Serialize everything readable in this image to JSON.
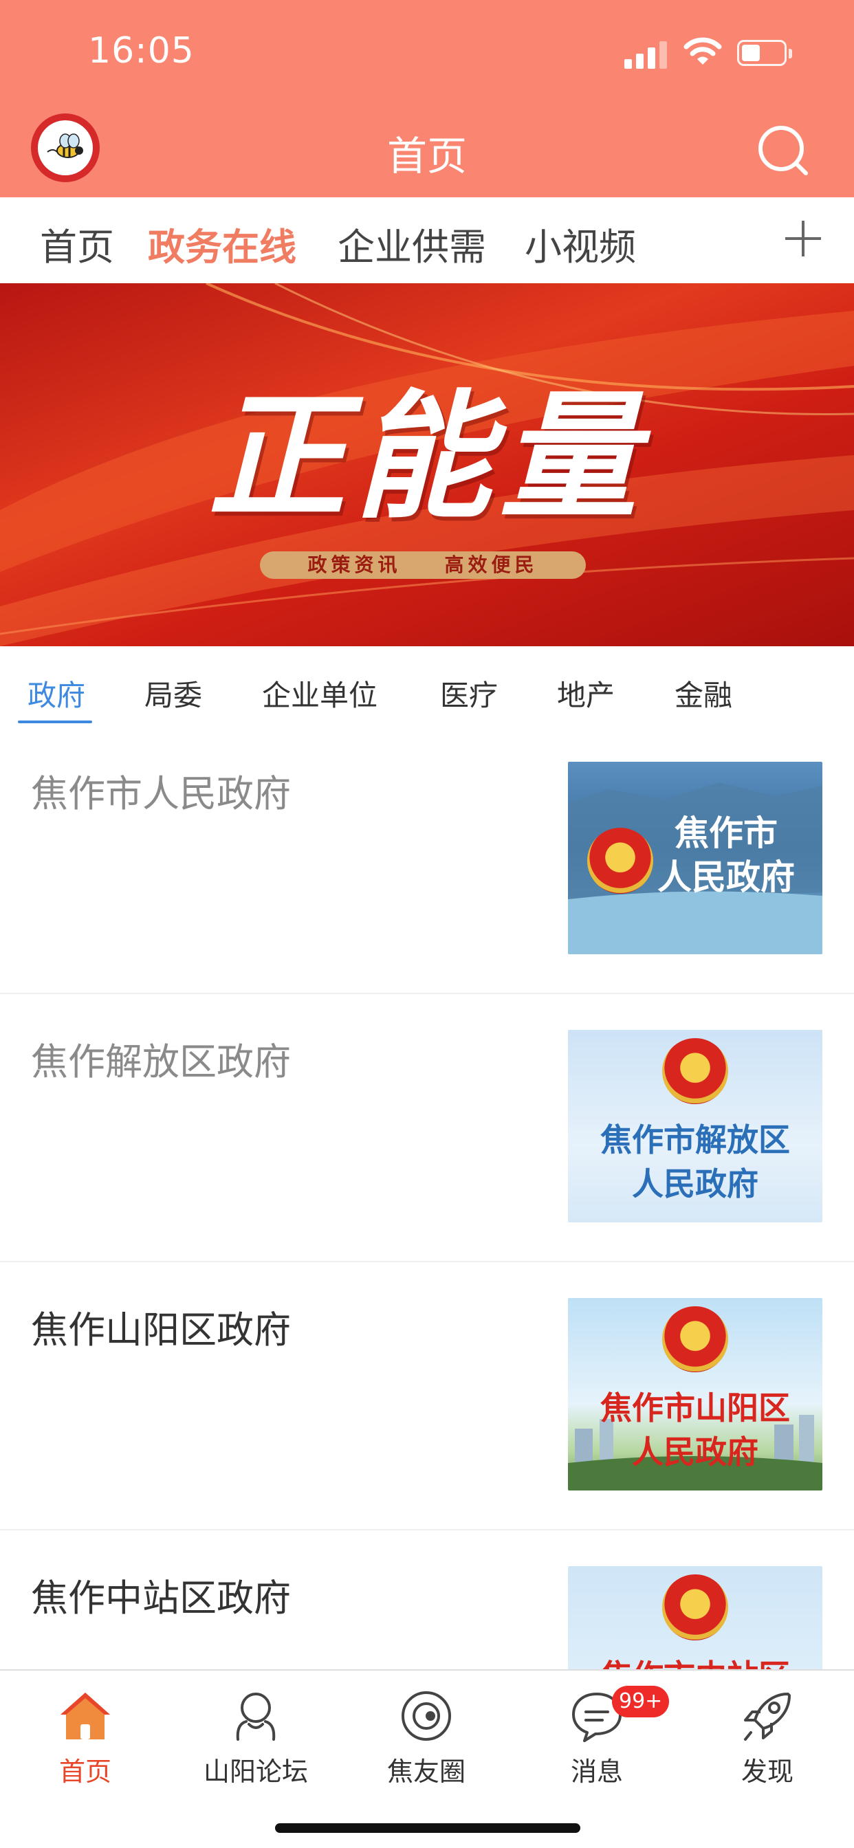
{
  "status_bar": {
    "time": "16:05",
    "battery_level": 0.45
  },
  "header": {
    "title": "首页",
    "avatar_icon": "bee-logo-icon",
    "search_icon": "search-icon",
    "bg_color": "#fa8570"
  },
  "channel_tabs": {
    "items": [
      {
        "label": "首页",
        "active": false
      },
      {
        "label": "政务在线",
        "active": true
      },
      {
        "label": "企业供需",
        "active": false
      },
      {
        "label": "小视频",
        "active": false
      }
    ],
    "add_icon": "plus-icon",
    "active_color": "#f07c62"
  },
  "banner": {
    "headline": "正能量",
    "subline": "政策资讯    高效便民"
  },
  "category_tabs": {
    "items": [
      {
        "label": "政府",
        "active": true
      },
      {
        "label": "局委",
        "active": false
      },
      {
        "label": "企业单位",
        "active": false
      },
      {
        "label": "医疗",
        "active": false
      },
      {
        "label": "地产",
        "active": false
      },
      {
        "label": "金融",
        "active": false
      }
    ],
    "active_color": "#3d8ae0"
  },
  "list": {
    "items": [
      {
        "title": "焦作市人民政府",
        "read": true,
        "thumb_text": "焦作市\n人民政府",
        "thumb_text_color": "#ffffff"
      },
      {
        "title": "焦作解放区政府",
        "read": true,
        "thumb_text": "焦作市解放区\n人民政府",
        "thumb_text_color": "#2a6fb8"
      },
      {
        "title": "焦作山阳区政府",
        "read": false,
        "thumb_text": "焦作市山阳区\n人民政府",
        "thumb_text_color": "#d8261f"
      },
      {
        "title": "焦作中站区政府",
        "read": false,
        "thumb_text": "焦作市中站区",
        "thumb_text_color": "#d8261f"
      }
    ]
  },
  "bottom_nav": {
    "items": [
      {
        "label": "首页",
        "icon": "home-icon",
        "active": true
      },
      {
        "label": "山阳论坛",
        "icon": "forum-icon",
        "active": false
      },
      {
        "label": "焦友圈",
        "icon": "circle-icon",
        "active": false
      },
      {
        "label": "消息",
        "icon": "message-icon",
        "active": false,
        "badge": "99+"
      },
      {
        "label": "发现",
        "icon": "rocket-icon",
        "active": false
      }
    ],
    "active_color": "#e8462a"
  }
}
